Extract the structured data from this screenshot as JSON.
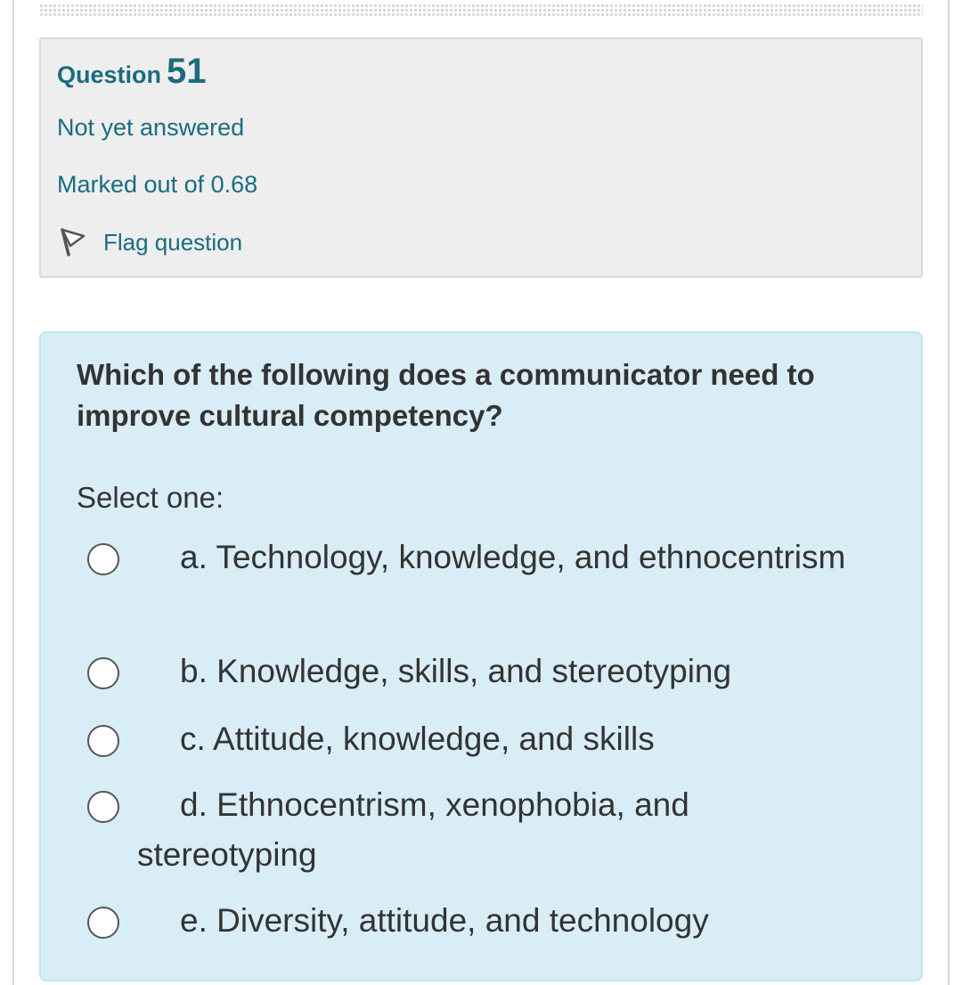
{
  "question_info": {
    "label": "Question",
    "number": "51",
    "status": "Not yet answered",
    "marks": "Marked out of 0.68",
    "flag_label": "Flag question",
    "flag_icon": "flag-icon"
  },
  "question": {
    "text": "Which of the following does a communicator need to improve cultural competency?",
    "prompt": "Select one:",
    "options": [
      {
        "label": "a. Technology, knowledge, and ethnocentrism",
        "selected": false
      },
      {
        "label": "b. Knowledge, skills, and stereotyping",
        "selected": false
      },
      {
        "label": "c. Attitude, knowledge, and skills",
        "selected": false
      },
      {
        "label": "d. Ethnocentrism, xenophobia, and stereotyping",
        "selected": false
      },
      {
        "label": "e. Diversity, attitude, and technology",
        "selected": false
      }
    ]
  },
  "colors": {
    "info_text": "#1a6c80",
    "info_background": "#eeeeee",
    "content_background": "#d9edf7",
    "content_border": "#c5e3f0",
    "body_text": "#333333"
  }
}
